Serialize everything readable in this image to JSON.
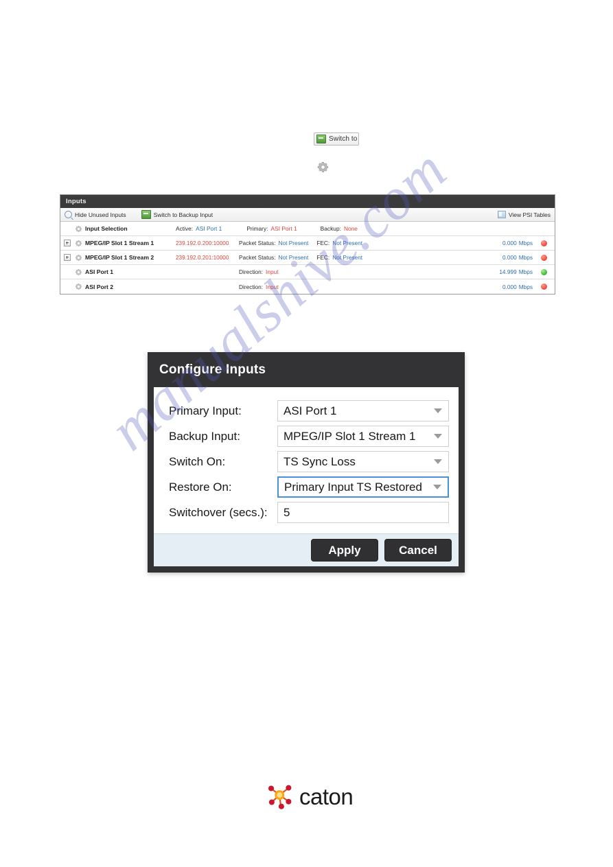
{
  "switch_to_button": {
    "label": "Switch to",
    "icon": "switch-green-icon"
  },
  "standalone_gear": {
    "icon": "gear-icon"
  },
  "inputs_panel": {
    "title": "Inputs",
    "toolbar": {
      "hide_unused_label": "Hide Unused Inputs",
      "hide_unused_icon": "magnifier-icon",
      "switch_backup_label": "Switch to Backup Input",
      "switch_backup_icon": "switch-green-icon",
      "view_psi_label": "View PSI Tables",
      "view_psi_icon": "psi-table-icon"
    },
    "selection_row": {
      "gear_icon": "gear-icon",
      "name": "Input Selection",
      "active_label": "Active:",
      "active_value": "ASI Port 1",
      "primary_label": "Primary:",
      "primary_value": "ASI Port 1",
      "backup_label": "Backup:",
      "backup_value": "None"
    },
    "rows": [
      {
        "expand_icon": "expand-plus-icon",
        "gear_icon": "gear-icon",
        "name": "MPEG/IP Slot 1 Stream 1",
        "address": "239.192.0.200:10000",
        "packet_status_label": "Packet Status:",
        "packet_status_value": "Not Present",
        "fec_label": "FEC:",
        "fec_value": "Not Present",
        "direction_label": "",
        "direction_value": "",
        "rate": "0.000",
        "unit": "Mbps",
        "led": "red"
      },
      {
        "expand_icon": "expand-plus-icon",
        "gear_icon": "gear-icon",
        "name": "MPEG/IP Slot 1 Stream 2",
        "address": "239.192.0.201:10000",
        "packet_status_label": "Packet Status:",
        "packet_status_value": "Not Present",
        "fec_label": "FEC:",
        "fec_value": "Not Present",
        "direction_label": "",
        "direction_value": "",
        "rate": "0.000",
        "unit": "Mbps",
        "led": "red"
      },
      {
        "expand_icon": "",
        "gear_icon": "gear-icon",
        "name": "ASI Port 1",
        "address": "",
        "packet_status_label": "",
        "packet_status_value": "",
        "fec_label": "",
        "fec_value": "",
        "direction_label": "Direction:",
        "direction_value": "Input",
        "rate": "14.999",
        "unit": "Mbps",
        "led": "green"
      },
      {
        "expand_icon": "",
        "gear_icon": "gear-icon",
        "name": "ASI Port 2",
        "address": "",
        "packet_status_label": "",
        "packet_status_value": "",
        "fec_label": "",
        "fec_value": "",
        "direction_label": "Direction:",
        "direction_value": "Input",
        "rate": "0.000",
        "unit": "Mbps",
        "led": "red"
      }
    ]
  },
  "config_dialog": {
    "title": "Configure Inputs",
    "fields": [
      {
        "label": "Primary Input:",
        "value": "ASI Port 1",
        "type": "select",
        "focused": false
      },
      {
        "label": "Backup Input:",
        "value": "MPEG/IP Slot 1 Stream 1",
        "type": "select",
        "focused": false
      },
      {
        "label": "Switch On:",
        "value": "TS Sync Loss",
        "type": "select",
        "focused": false
      },
      {
        "label": "Restore On:",
        "value": "Primary Input TS Restored",
        "type": "select",
        "focused": true
      },
      {
        "label": "Switchover (secs.):",
        "value": "5",
        "type": "text",
        "focused": false
      }
    ],
    "apply_label": "Apply",
    "cancel_label": "Cancel"
  },
  "footer_logo": {
    "wordmark": "caton",
    "mark_icon": "caton-molecule-icon",
    "colors": {
      "dark_red": "#c9182b",
      "orange": "#f07d12",
      "yellow": "#fbb034"
    }
  },
  "watermark": {
    "text": "manualshive.com"
  },
  "colors": {
    "panel_header": "#3b3b3b",
    "dialog_bg": "#333336",
    "dialog_footer": "#e4eef4",
    "accent_blue": "#2f6fb0",
    "accent_red": "#e0453c",
    "focus_blue": "#4a90d9",
    "led_green": "#35b438",
    "led_red": "#e8483a"
  }
}
